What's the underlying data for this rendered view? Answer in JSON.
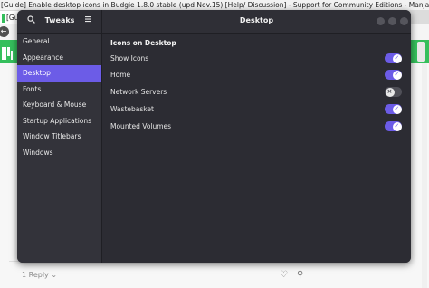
{
  "browser": {
    "title": "[Guide] Enable desktop icons in Budgie 1.8.0 stable (upd Nov.15) [Help/ Discussion] - Support for Community Editions - Manjaro Linux Forum - ...",
    "tab_label": "[Guid",
    "back_icon": "back-arrow-icon",
    "accent_color": "#35bf5c",
    "post": {
      "reply_label": "1 Reply",
      "reply_icon": "chevron-down-icon",
      "like_icon": "heart-icon",
      "link_icon": "link-icon"
    }
  },
  "window": {
    "sidebar_title": "Tweaks",
    "search_icon": "search-icon",
    "menu_icon": "hamburger-menu-icon",
    "page_title": "Desktop",
    "accent_color": "#6c5ce7",
    "sidebar_items": [
      {
        "label": "General"
      },
      {
        "label": "Appearance"
      },
      {
        "label": "Desktop",
        "active": true
      },
      {
        "label": "Fonts"
      },
      {
        "label": "Keyboard & Mouse"
      },
      {
        "label": "Startup Applications"
      },
      {
        "label": "Window Titlebars"
      },
      {
        "label": "Windows"
      }
    ],
    "section_title": "Icons on Desktop",
    "settings": [
      {
        "label": "Show Icons",
        "enabled": true
      },
      {
        "label": "Home",
        "enabled": true
      },
      {
        "label": "Network Servers",
        "enabled": false
      },
      {
        "label": "Wastebasket",
        "enabled": true
      },
      {
        "label": "Mounted Volumes",
        "enabled": true
      }
    ]
  }
}
